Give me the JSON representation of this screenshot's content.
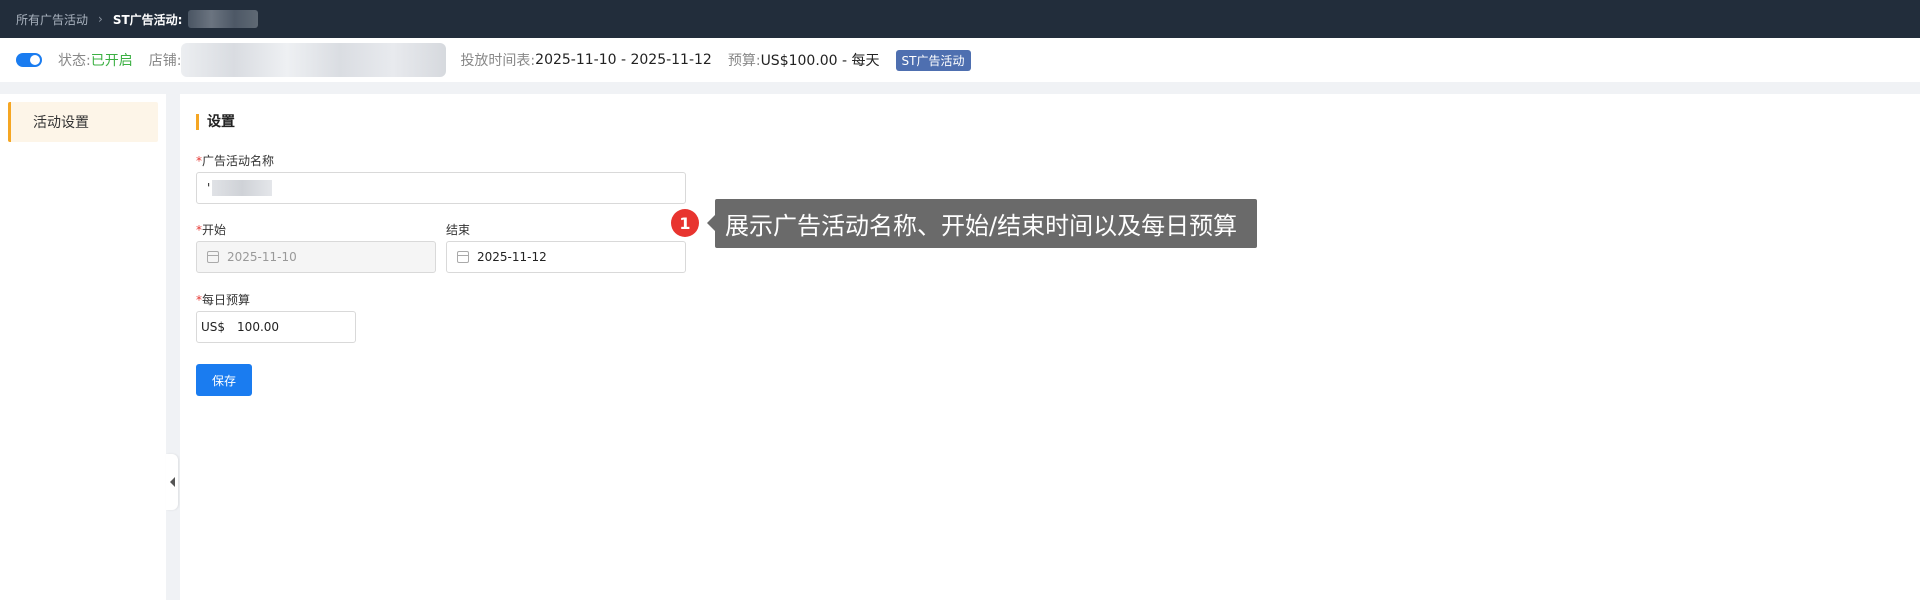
{
  "breadcrumb": {
    "parent": "所有广告活动",
    "current_prefix": "ST广告活动:"
  },
  "info": {
    "status_label": "状态:",
    "status_value": "已开启",
    "store_label": "店铺:",
    "schedule_label": "投放时间表:",
    "schedule_value": "2025-11-10 - 2025-11-12",
    "budget_label": "预算:",
    "budget_value": "US$100.00 - 每天",
    "type_badge": "ST广告活动"
  },
  "sidebar": {
    "items": [
      {
        "label": "活动设置"
      }
    ]
  },
  "form": {
    "section_title": "设置",
    "name_label": "广告活动名称",
    "name_value_prefix": "'",
    "start_label": "开始",
    "start_value": "2025-11-10",
    "end_label": "结束",
    "end_value": "2025-11-12",
    "budget_label": "每日预算",
    "budget_currency": "US$",
    "budget_value": "100.00",
    "required_mark": "*",
    "save_label": "保存"
  },
  "callout": {
    "number": "1",
    "text": "展示广告活动名称、开始/结束时间以及每日预算"
  },
  "colors": {
    "topbar": "#222d3b",
    "accent": "#1a7cf0",
    "status_on": "#3cb043",
    "sidebar_active": "#f5a623",
    "callout_badge": "#e8342f",
    "callout_box": "#6a6a6a"
  }
}
